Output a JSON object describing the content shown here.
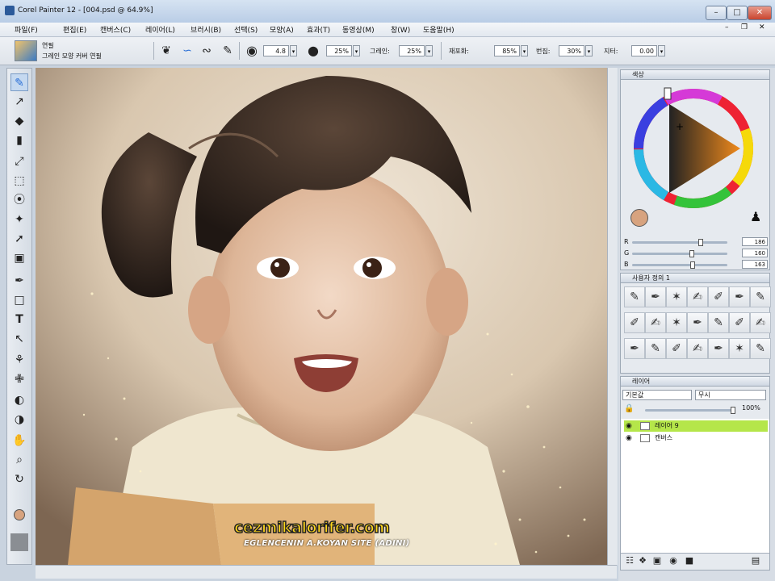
{
  "window": {
    "title": "Corel Painter 12 - [004.psd @ 64.9%]"
  },
  "menu": {
    "items": [
      "파일(F)",
      "편집(E)",
      "캔버스(C)",
      "레이어(L)",
      "브러시(B)",
      "선택(S)",
      "모양(A)",
      "효과(T)",
      "동영상(M)",
      "창(W)",
      "도움말(H)"
    ]
  },
  "property_bar": {
    "brush_category": "연필",
    "brush_variant": "그레인 모양 커버 연필",
    "size_value": "4.8",
    "opacity_value": "25%",
    "grain_label": "그레인:",
    "grain_value": "25%",
    "resat_label": "재포화:",
    "resat_value": "85%",
    "bleed_label": "번짐:",
    "bleed_value": "30%",
    "jitter_label": "지터:",
    "jitter_value": "0.00"
  },
  "color_panel": {
    "title": "색상",
    "r_label": "R",
    "g_label": "G",
    "b_label": "B",
    "r_value": "186",
    "g_value": "160",
    "b_value": "163",
    "r_level": 0.73,
    "g_level": 0.63,
    "b_level": 0.64,
    "current_color": "#d7a37f"
  },
  "brushes_panel": {
    "title": "사용자 정의 1"
  },
  "layers_panel": {
    "title": "레이어",
    "composite_method": "기본값",
    "lock_mode": "무시",
    "opacity_value": "100%",
    "layers": [
      {
        "name": "레이어 9",
        "selected": true
      },
      {
        "name": "캔버스",
        "selected": false
      }
    ]
  },
  "watermark": {
    "site": "cezmikalorifer.com",
    "tagline": "EGLENCENIN A.KOYAN SITE (ADINI)"
  },
  "colors": {
    "selection_green": "#b5e64a",
    "accent_blue": "#7a9cc6"
  }
}
